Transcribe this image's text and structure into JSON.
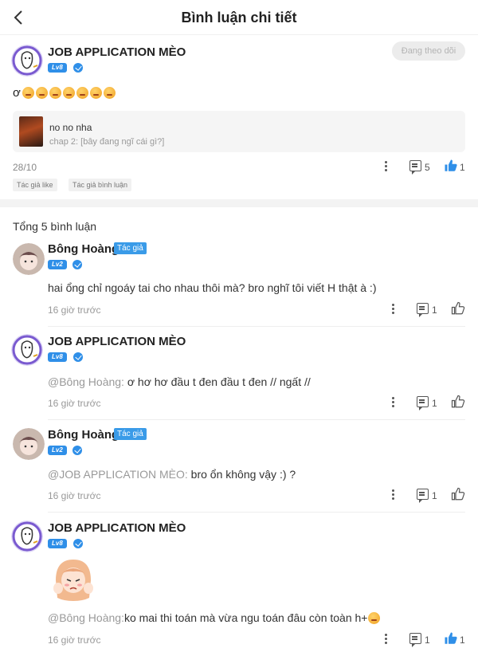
{
  "header": {
    "title": "Bình luận chi tiết"
  },
  "post": {
    "user": "JOB APPLICATION MÈO",
    "level": "Lv8",
    "follow_label": "Đang theo dõi",
    "text_prefix": "ơ",
    "emoji_count": 7,
    "chapter_title": "no no nha",
    "chapter_sub": "chap 2: [bây đang ngĩ cái gì?]",
    "date": "28/10",
    "comment_count": "5",
    "like_count": "1",
    "tags": [
      "Tác giả like",
      "Tác giả bình luận"
    ]
  },
  "total_label": "Tổng 5 bình luận",
  "replies": [
    {
      "user": "Bông Hoàng",
      "badge": "Tác giả",
      "level": "Lv2",
      "text": "hai ổng chỉ ngoáy tai cho nhau thôi mà? bro nghĩ tôi viết H thật à :)",
      "time": "16 giờ trước",
      "comments": "1"
    },
    {
      "user": "JOB APPLICATION MÈO",
      "level": "Lv8",
      "mention": "@Bông Hoàng:",
      "text": " ơ hơ hơ đầu t đen đầu t đen // ngất //",
      "time": "16 giờ trước",
      "comments": "1"
    },
    {
      "user": "Bông Hoàng",
      "badge": "Tác giả",
      "level": "Lv2",
      "mention": "@JOB APPLICATION MÈO:",
      "text": " bro ổn không vậy :) ?",
      "time": "16 giờ trước",
      "comments": "1"
    },
    {
      "user": "JOB APPLICATION MÈO",
      "level": "Lv8",
      "mention": "@Bông Hoàng:",
      "text": " ko mai thi toán mà vừa ngu toán đâu còn toàn h+",
      "time": "16 giờ trước",
      "comments": "1",
      "likes": "1"
    }
  ],
  "colors": {
    "accent": "#2f8fe8",
    "muted": "#999999"
  }
}
